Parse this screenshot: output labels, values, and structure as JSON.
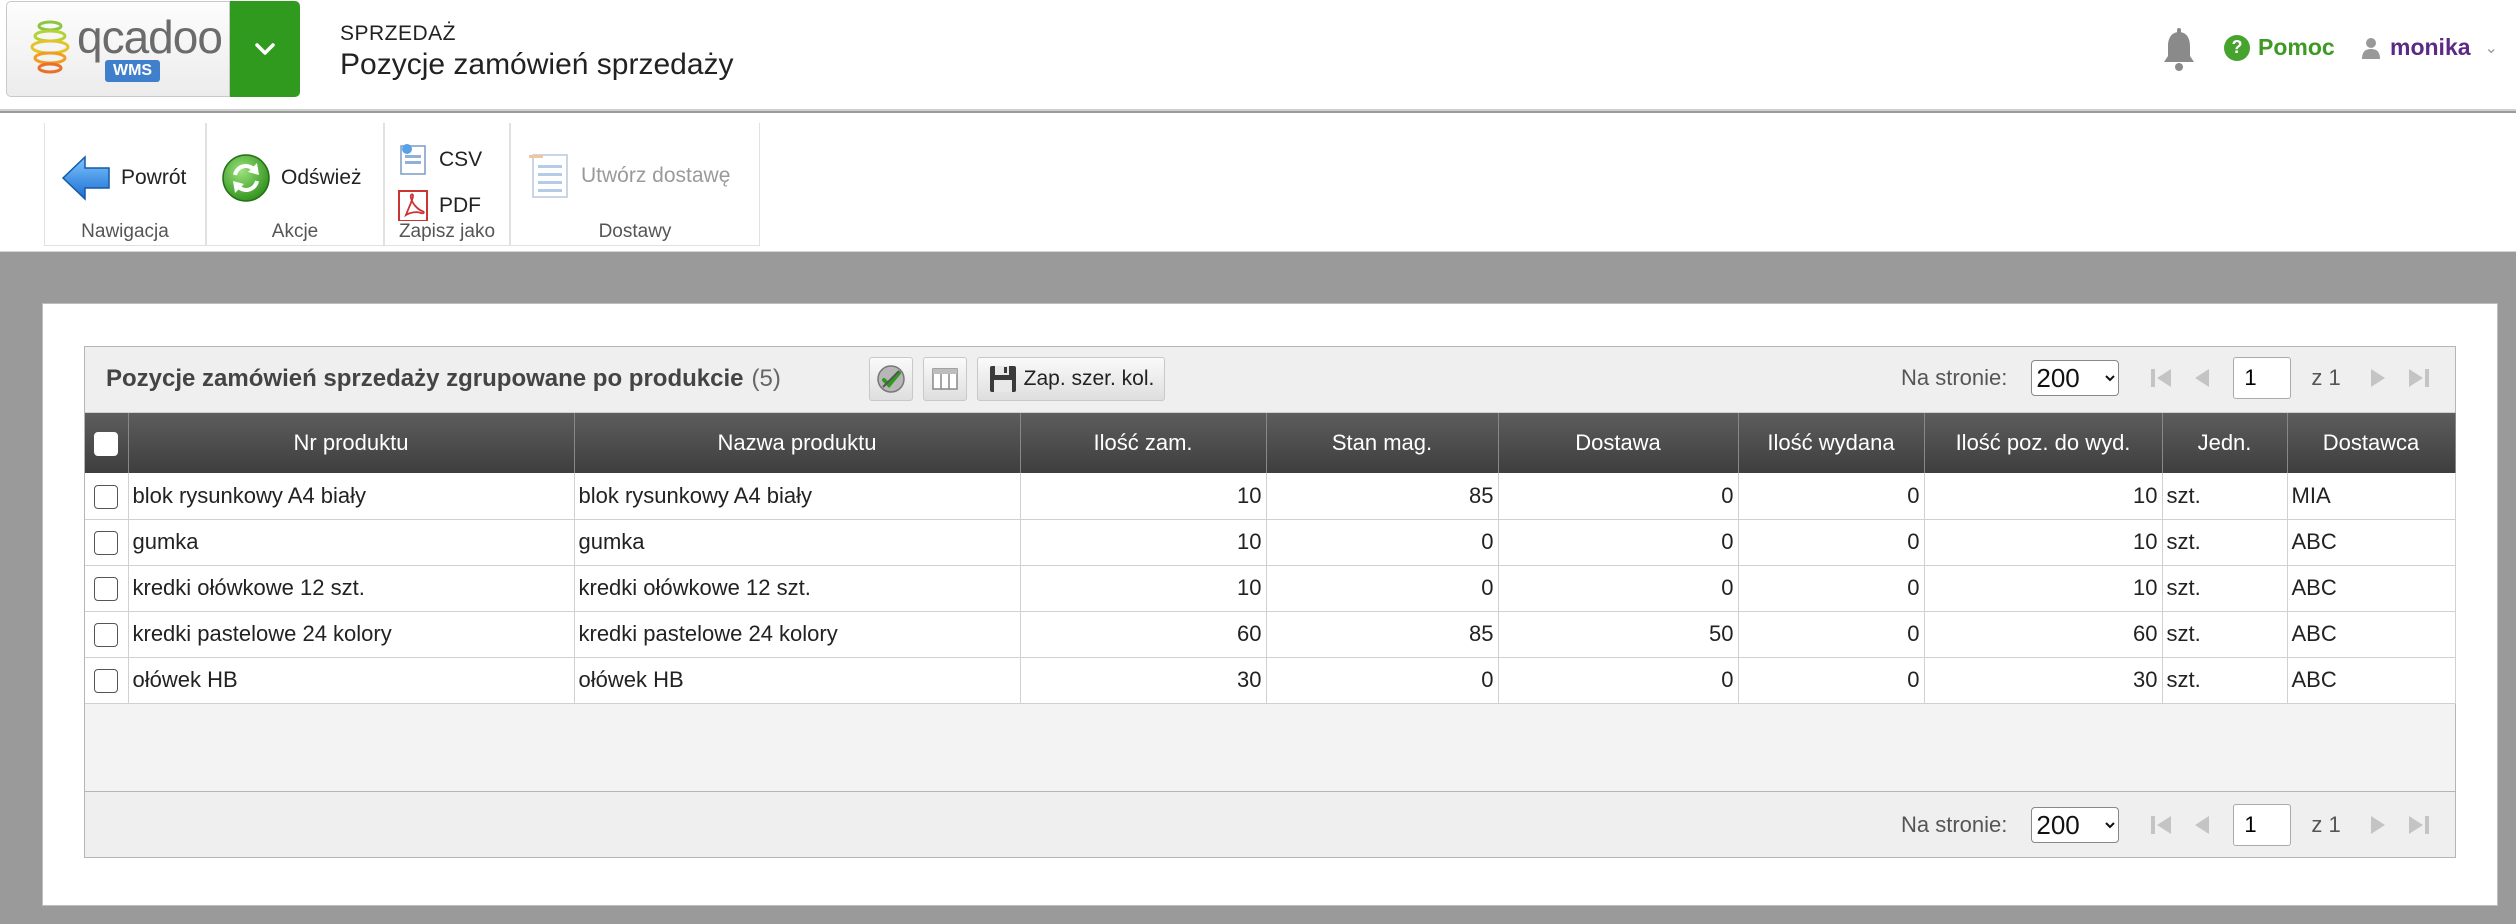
{
  "app": {
    "logo_text": "qcadoo",
    "logo_badge": "WMS"
  },
  "header": {
    "section": "SPRZEDAŻ",
    "title": "Pozycje zamówień sprzedaży",
    "help_label": "Pomoc",
    "user_label": "monika"
  },
  "ribbon": {
    "groups": [
      {
        "label": "Nawigacja",
        "buttons": [
          {
            "label": "Powrót",
            "icon": "arrow-left-icon"
          }
        ]
      },
      {
        "label": "Akcje",
        "buttons": [
          {
            "label": "Odśwież",
            "icon": "refresh-icon"
          }
        ]
      },
      {
        "label": "Zapisz jako",
        "buttons": [
          {
            "label": "CSV",
            "icon": "csv-icon"
          },
          {
            "label": "PDF",
            "icon": "pdf-icon"
          }
        ]
      },
      {
        "label": "Dostawy",
        "buttons": [
          {
            "label": "Utwórz dostawę",
            "icon": "list-icon",
            "disabled": true
          }
        ]
      }
    ]
  },
  "grid": {
    "title": "Pozycje zamówień sprzedaży zgrupowane po produkcie",
    "count": "(5)",
    "save_widths_label": "Zap. szer. kol.",
    "pager": {
      "per_page_label": "Na stronie:",
      "per_page": "200",
      "page": "1",
      "of_label": "z 1"
    },
    "columns": [
      "Nr produktu",
      "Nazwa produktu",
      "Ilość zam.",
      "Stan mag.",
      "Dostawa",
      "Ilość wydana",
      "Ilość poz. do wyd.",
      "Jedn.",
      "Dostawca"
    ],
    "rows": [
      [
        "blok rysunkowy A4 biały",
        "blok rysunkowy A4 biały",
        "10",
        "85",
        "0",
        "0",
        "10",
        "szt.",
        "MIA"
      ],
      [
        "gumka",
        "gumka",
        "10",
        "0",
        "0",
        "0",
        "10",
        "szt.",
        "ABC"
      ],
      [
        "kredki ołówkowe 12 szt.",
        "kredki ołówkowe 12 szt.",
        "10",
        "0",
        "0",
        "0",
        "10",
        "szt.",
        "ABC"
      ],
      [
        "kredki pastelowe 24 kolory",
        "kredki pastelowe 24 kolory",
        "60",
        "85",
        "50",
        "0",
        "60",
        "szt.",
        "ABC"
      ],
      [
        "ołówek HB",
        "ołówek HB",
        "30",
        "0",
        "0",
        "0",
        "30",
        "szt.",
        "ABC"
      ]
    ]
  },
  "colors": {
    "brand_green": "#2f9a1d",
    "help_green": "#3f9a25",
    "user_purple": "#5b2a86",
    "header_dark": "#4a4a4a"
  }
}
